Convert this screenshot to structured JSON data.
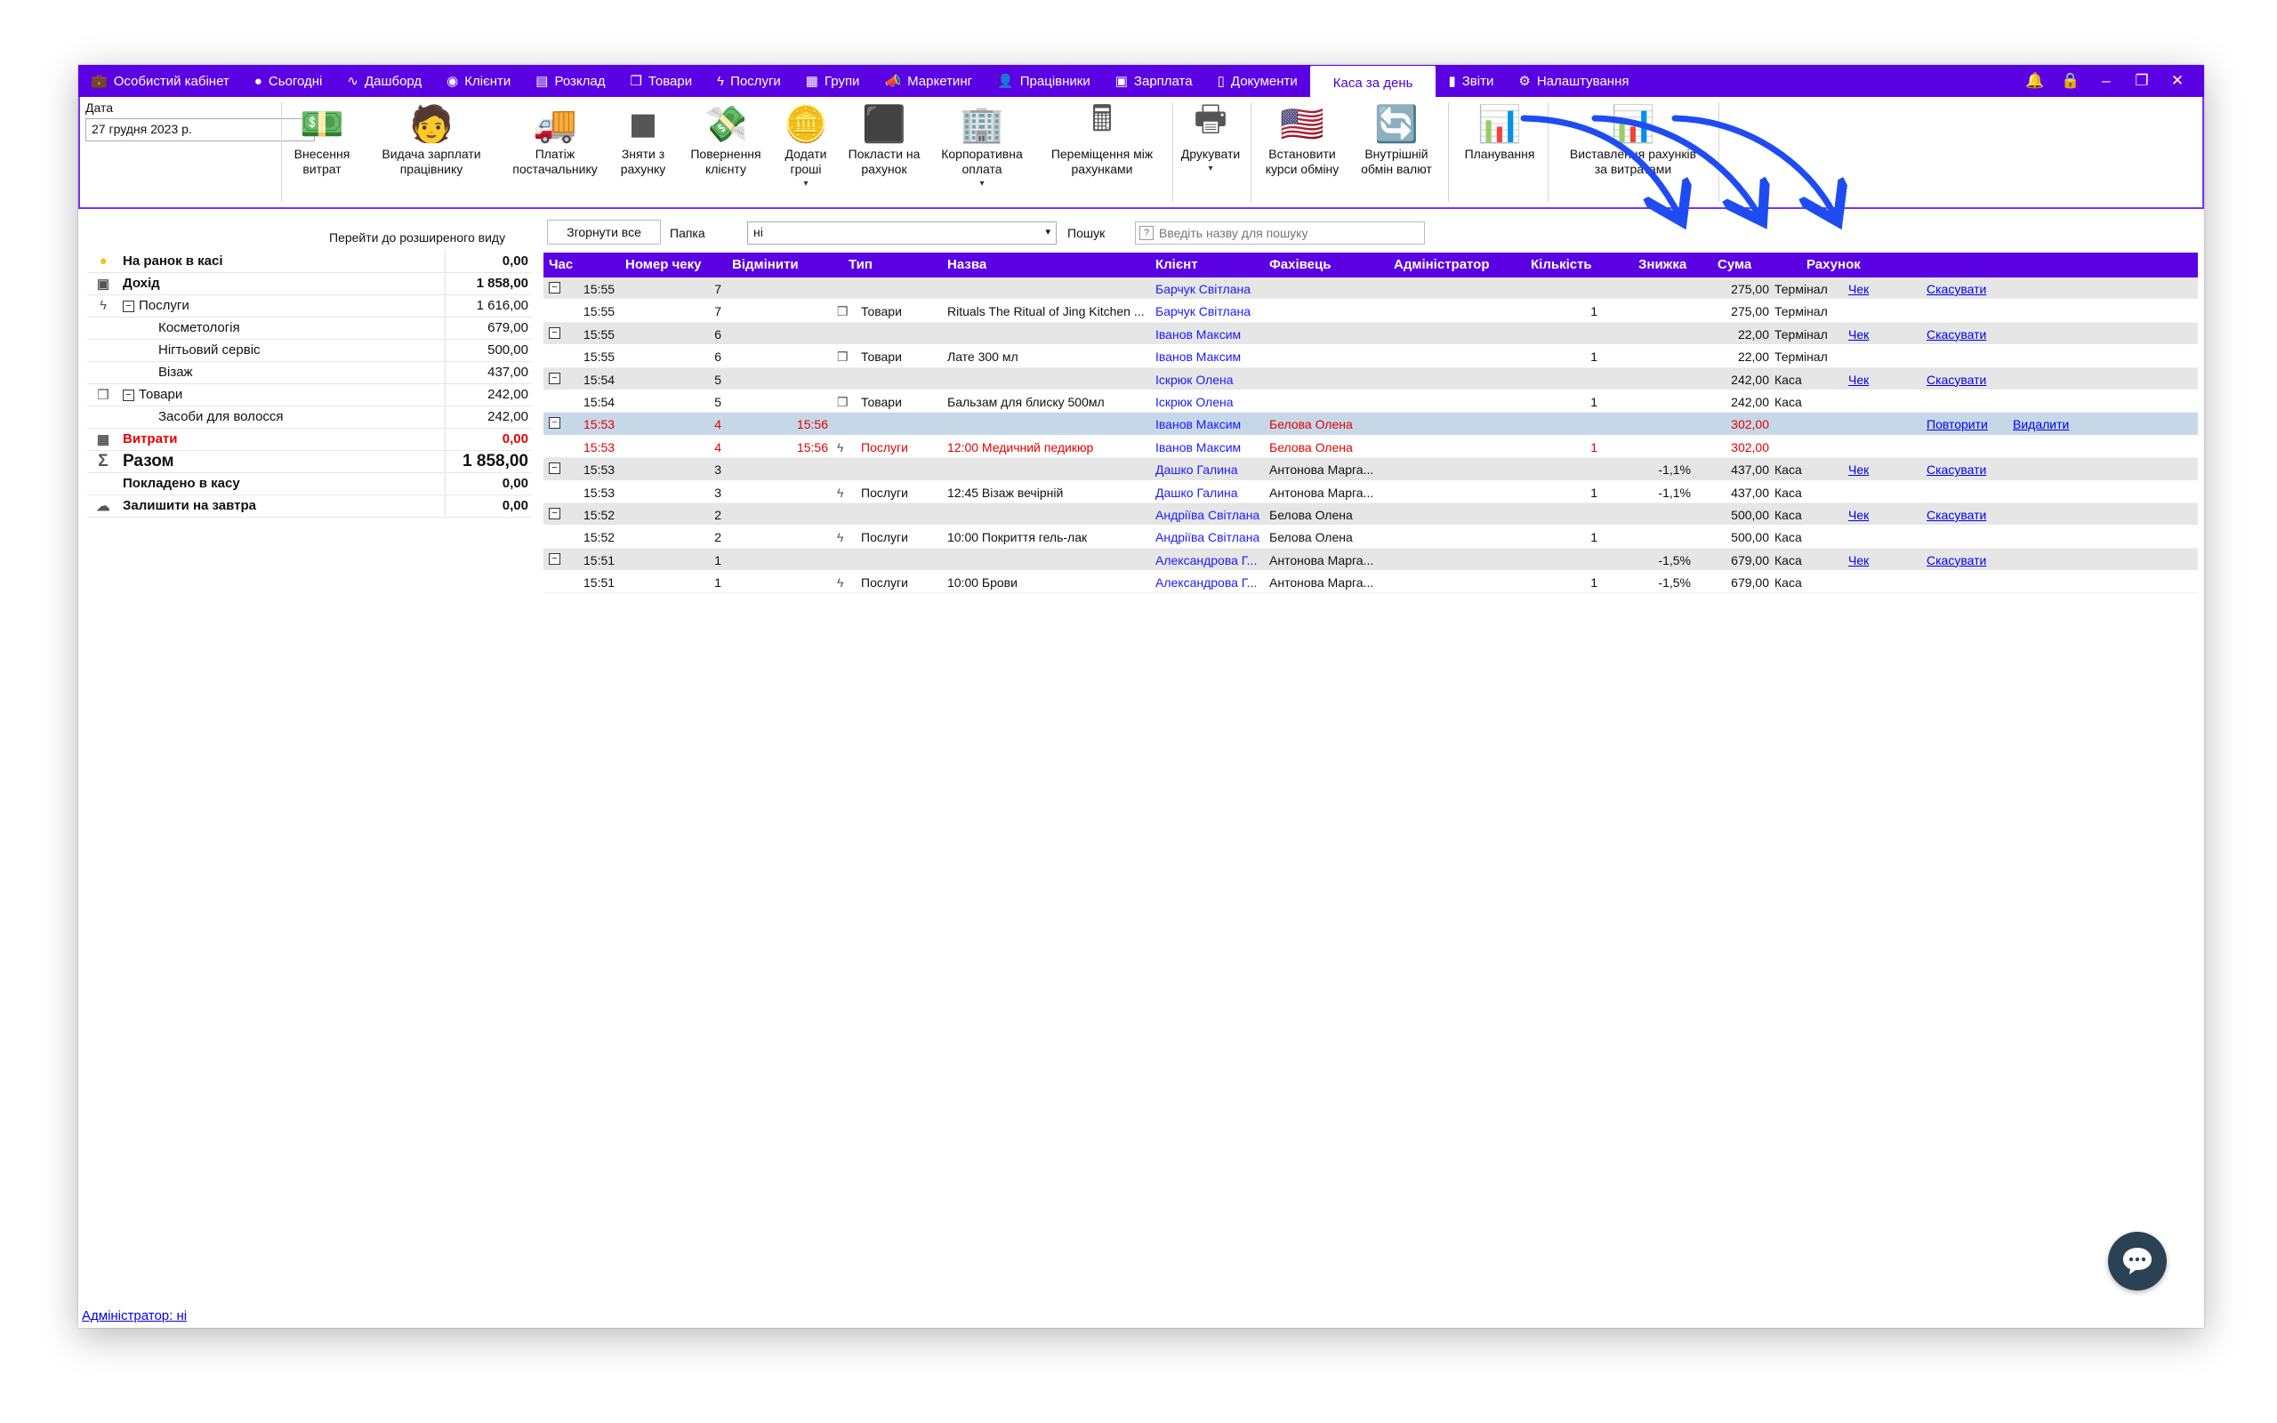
{
  "menu": {
    "items": [
      {
        "icon": "briefcase-icon",
        "glyph": "💼",
        "label": "Особистий кабінет"
      },
      {
        "icon": "clock-icon",
        "glyph": "●",
        "label": "Сьогодні"
      },
      {
        "icon": "pulse-icon",
        "glyph": "∿",
        "label": "Дашборд"
      },
      {
        "icon": "user-circle-icon",
        "glyph": "◉",
        "label": "Клієнти"
      },
      {
        "icon": "calendar-icon",
        "glyph": "▤",
        "label": "Розклад"
      },
      {
        "icon": "box-icon",
        "glyph": "❒",
        "label": "Товари"
      },
      {
        "icon": "bolt-icon",
        "glyph": "ϟ",
        "label": "Послуги"
      },
      {
        "icon": "groups-icon",
        "glyph": "▦",
        "label": "Групи"
      },
      {
        "icon": "megaphone-icon",
        "glyph": "📣",
        "label": "Маркетинг"
      },
      {
        "icon": "person-icon",
        "glyph": "👤",
        "label": "Працівники"
      },
      {
        "icon": "money-icon",
        "glyph": "▣",
        "label": "Зарплата"
      },
      {
        "icon": "document-icon",
        "glyph": "▯",
        "label": "Документи"
      },
      {
        "icon": "",
        "glyph": "",
        "label": "Каса за день",
        "active": true
      },
      {
        "icon": "bar-chart-icon",
        "glyph": "▮",
        "label": "Звіти"
      },
      {
        "icon": "gear-icon",
        "glyph": "⚙",
        "label": "Налаштування"
      }
    ]
  },
  "toolbar": {
    "date_label": "Дата",
    "date_value": "27 грудня  2023 р.",
    "buttons": [
      {
        "name": "expense-entry-button",
        "icon": "cash-icon",
        "glyph": "💵",
        "label": "Внесення\nвитрат",
        "dropdown": false
      },
      {
        "name": "pay-salary-button",
        "icon": "employee-money-icon",
        "glyph": "🧑",
        "label": "Видача зарплати\nпрацівнику",
        "dropdown": false
      },
      {
        "name": "supplier-payment-button",
        "icon": "truck-icon",
        "glyph": "🚚",
        "label": "Платіж\nпостачальнику",
        "dropdown": false
      },
      {
        "name": "withdraw-from-account-button",
        "icon": "safe-icon",
        "glyph": "◼",
        "label": "Зняти з\nрахунку",
        "dropdown": false
      },
      {
        "name": "client-refund-button",
        "icon": "refund-icon",
        "glyph": "💸",
        "label": "Повернення\nклієнту",
        "dropdown": false
      },
      {
        "name": "add-money-button",
        "icon": "coins-icon",
        "glyph": "🪙",
        "label": "Додати\nгроші",
        "dropdown": true
      },
      {
        "name": "deposit-to-account-button",
        "icon": "safe-box-icon",
        "glyph": "⬛",
        "label": "Покласти на\nрахунок",
        "dropdown": false
      },
      {
        "name": "corporate-payment-button",
        "icon": "building-icon",
        "glyph": "🏢",
        "label": "Корпоративна\nоплата",
        "dropdown": true
      },
      {
        "name": "transfer-between-accounts-button",
        "icon": "calculator-icon",
        "glyph": "🖩",
        "label": "Переміщення між\nрахунками",
        "dropdown": false
      },
      {
        "name": "print-button",
        "icon": "printer-icon",
        "glyph": "🖶",
        "label": "Друкувати",
        "dropdown": true
      },
      {
        "name": "set-exchange-rates-button",
        "icon": "flags-icon",
        "glyph": "🇺🇸",
        "label": "Встановити\nкурси обміну",
        "dropdown": false
      },
      {
        "name": "currency-exchange-button",
        "icon": "exchange-icon",
        "glyph": "🔄",
        "label": "Внутрішній\nобмін валют",
        "dropdown": false
      },
      {
        "name": "planning-button",
        "icon": "bar-chart-icon",
        "glyph": "📊",
        "label": "Планування",
        "dropdown": false
      },
      {
        "name": "invoice-expenses-button",
        "icon": "bar-chart-icon",
        "glyph": "📊",
        "label": "Виставлення рахунків\nза витратами",
        "dropdown": false
      }
    ]
  },
  "summary": {
    "expanded_view_link": "Перейти до розширеного виду",
    "rows": [
      {
        "icon": "coin-icon",
        "glyph": "●",
        "label": "На ранок в касі",
        "value": "0,00",
        "style": "bold",
        "indent": 0
      },
      {
        "icon": "cash-icon",
        "glyph": "▣",
        "label": "Дохід",
        "value": "1 858,00",
        "style": "bold",
        "indent": 0
      },
      {
        "icon": "bolt-icon",
        "glyph": "ϟ",
        "label": "Послуги",
        "value": "1 616,00",
        "style": "",
        "indent": 0,
        "expander": true
      },
      {
        "icon": "",
        "glyph": "",
        "label": "Косметологія",
        "value": "679,00",
        "style": "",
        "indent": 2
      },
      {
        "icon": "",
        "glyph": "",
        "label": "Нігтьовий сервіс",
        "value": "500,00",
        "style": "",
        "indent": 2
      },
      {
        "icon": "",
        "glyph": "",
        "label": "Візаж",
        "value": "437,00",
        "style": "",
        "indent": 2
      },
      {
        "icon": "box-icon",
        "glyph": "❒",
        "label": "Товари",
        "value": "242,00",
        "style": "",
        "indent": 0,
        "expander": true
      },
      {
        "icon": "",
        "glyph": "",
        "label": "Засоби для волосся",
        "value": "242,00",
        "style": "",
        "indent": 2
      },
      {
        "icon": "calculator-icon",
        "glyph": "▦",
        "label": "Витрати",
        "value": "0,00",
        "style": "red",
        "indent": 0
      },
      {
        "icon": "sigma-icon",
        "glyph": "Σ",
        "label": "Разом",
        "value": "1 858,00",
        "style": "big",
        "indent": 0
      },
      {
        "icon": "",
        "glyph": "",
        "label": "Покладено в касу",
        "value": "0,00",
        "style": "bold",
        "indent": 0
      },
      {
        "icon": "cloud-icon",
        "glyph": "☁",
        "label": "Залишити на завтра",
        "value": "0,00",
        "style": "bold",
        "indent": 0
      }
    ]
  },
  "filters": {
    "collapse_all": "Згорнути все",
    "folder_label": "Папка",
    "folder_value": "ні",
    "search_label": "Пошук",
    "search_placeholder": "Введіть назву для пошуку"
  },
  "grid": {
    "columns": [
      "Час",
      "Номер чеку",
      "Відмінити",
      "Тип",
      "Назва",
      "Клієнт",
      "Фахівець",
      "Адміністратор",
      "Кількість",
      "Знижка",
      "Сума",
      "Рахунок"
    ],
    "rows": [
      {
        "kind": "parent",
        "time": "15:55",
        "check": "7",
        "cancel_time": "",
        "type_icon": "",
        "type": "",
        "name": "",
        "client": "Барчук Світлана",
        "specialist": "",
        "qty": "",
        "discount": "",
        "sum": "275,00",
        "account": "Термінал",
        "link1": "Чек",
        "link2": "Скасувати"
      },
      {
        "kind": "child",
        "time": "15:55",
        "check": "7",
        "cancel_time": "",
        "type_icon": "box",
        "type": "Товари",
        "name": "Rituals The Ritual of Jing Kitchen ...",
        "client": "Барчук Світлана",
        "specialist": "",
        "qty": "1",
        "discount": "",
        "sum": "275,00",
        "account": "Термінал",
        "link1": "",
        "link2": ""
      },
      {
        "kind": "parent",
        "time": "15:55",
        "check": "6",
        "cancel_time": "",
        "type_icon": "",
        "type": "",
        "name": "",
        "client": "Іванов Максим",
        "specialist": "",
        "qty": "",
        "discount": "",
        "sum": "22,00",
        "account": "Термінал",
        "link1": "Чек",
        "link2": "Скасувати"
      },
      {
        "kind": "child",
        "time": "15:55",
        "check": "6",
        "cancel_time": "",
        "type_icon": "box",
        "type": "Товари",
        "name": "Лате 300 мл",
        "client": "Іванов Максим",
        "specialist": "",
        "qty": "1",
        "discount": "",
        "sum": "22,00",
        "account": "Термінал",
        "link1": "",
        "link2": ""
      },
      {
        "kind": "parent",
        "time": "15:54",
        "check": "5",
        "cancel_time": "",
        "type_icon": "",
        "type": "",
        "name": "",
        "client": "Іскрюк Олена",
        "specialist": "",
        "qty": "",
        "discount": "",
        "sum": "242,00",
        "account": "Каса",
        "link1": "Чек",
        "link2": "Скасувати"
      },
      {
        "kind": "child",
        "time": "15:54",
        "check": "5",
        "cancel_time": "",
        "type_icon": "box",
        "type": "Товари",
        "name": "Бальзам для блиску 500мл",
        "client": "Іскрюк Олена",
        "specialist": "",
        "qty": "1",
        "discount": "",
        "sum": "242,00",
        "account": "Каса",
        "link1": "",
        "link2": ""
      },
      {
        "kind": "selected",
        "time": "15:53",
        "check": "4",
        "cancel_time": "15:56",
        "type_icon": "",
        "type": "",
        "name": "",
        "client": "Іванов Максим",
        "specialist": "Белова Олена",
        "qty": "",
        "discount": "",
        "sum": "302,00",
        "account": "",
        "link1": "Повторити",
        "link2": "Видалити",
        "red": true
      },
      {
        "kind": "child",
        "time": "15:53",
        "check": "4",
        "cancel_time": "15:56",
        "type_icon": "bolt",
        "type": "Послуги",
        "name": "12:00 Медичний педикюр",
        "client": "Іванов Максим",
        "specialist": "Белова Олена",
        "qty": "1",
        "discount": "",
        "sum": "302,00",
        "account": "",
        "link1": "",
        "link2": "",
        "red": true
      },
      {
        "kind": "parent",
        "time": "15:53",
        "check": "3",
        "cancel_time": "",
        "type_icon": "",
        "type": "",
        "name": "",
        "client": "Дашко Галина",
        "specialist": "Антонова Марга...",
        "qty": "",
        "discount": "-1,1%",
        "sum": "437,00",
        "account": "Каса",
        "link1": "Чек",
        "link2": "Скасувати"
      },
      {
        "kind": "child",
        "time": "15:53",
        "check": "3",
        "cancel_time": "",
        "type_icon": "bolt",
        "type": "Послуги",
        "name": "12:45 Візаж вечірній",
        "client": "Дашко Галина",
        "specialist": "Антонова Марга...",
        "qty": "1",
        "discount": "-1,1%",
        "sum": "437,00",
        "account": "Каса",
        "link1": "",
        "link2": ""
      },
      {
        "kind": "parent",
        "time": "15:52",
        "check": "2",
        "cancel_time": "",
        "type_icon": "",
        "type": "",
        "name": "",
        "client": "Андріїва Світлана",
        "specialist": "Белова Олена",
        "qty": "",
        "discount": "",
        "sum": "500,00",
        "account": "Каса",
        "link1": "Чек",
        "link2": "Скасувати"
      },
      {
        "kind": "child",
        "time": "15:52",
        "check": "2",
        "cancel_time": "",
        "type_icon": "bolt",
        "type": "Послуги",
        "name": "10:00 Покриття гель-лак",
        "client": "Андріїва Світлана",
        "specialist": "Белова Олена",
        "qty": "1",
        "discount": "",
        "sum": "500,00",
        "account": "Каса",
        "link1": "",
        "link2": ""
      },
      {
        "kind": "parent",
        "time": "15:51",
        "check": "1",
        "cancel_time": "",
        "type_icon": "",
        "type": "",
        "name": "",
        "client": "Александрова Г...",
        "specialist": "Антонова Марга...",
        "qty": "",
        "discount": "-1,5%",
        "sum": "679,00",
        "account": "Каса",
        "link1": "Чек",
        "link2": "Скасувати"
      },
      {
        "kind": "child",
        "time": "15:51",
        "check": "1",
        "cancel_time": "",
        "type_icon": "bolt",
        "type": "Послуги",
        "name": "10:00 Брови",
        "client": "Александрова Г...",
        "specialist": "Антонова Марга...",
        "qty": "1",
        "discount": "-1,5%",
        "sum": "679,00",
        "account": "Каса",
        "link1": "",
        "link2": ""
      }
    ]
  },
  "footer": {
    "admin_link": "Адміністратор: ні"
  },
  "colors": {
    "accent": "#5a00e3",
    "selected_row": "#c6d8e8",
    "cancelled": "#e60000",
    "link": "#0000ee",
    "chat": "#2b4254",
    "arrow": "#1f4cf2"
  }
}
